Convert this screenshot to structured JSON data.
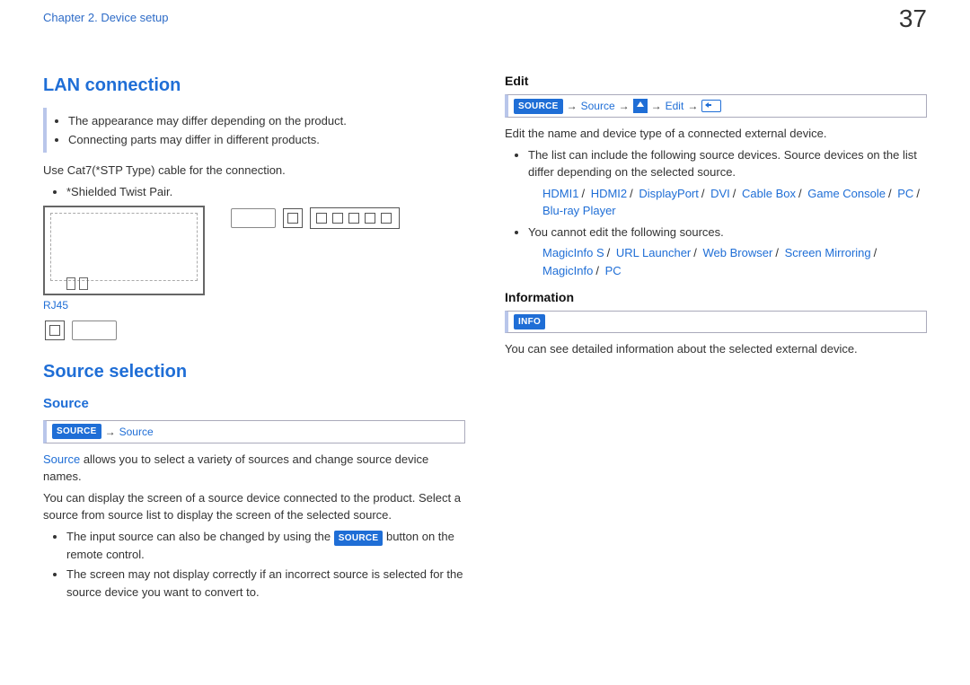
{
  "header": {
    "chapter": "Chapter 2. Device setup",
    "page_number": "37"
  },
  "left": {
    "lan_heading": "LAN connection",
    "lan_notes": [
      "The appearance may differ depending on the product.",
      "Connecting parts may differ in different products."
    ],
    "cable_line": "Use Cat7(*STP Type) cable for the connection.",
    "stp_note": "*Shielded Twist Pair.",
    "rj45_label": "RJ45",
    "source_sel_heading": "Source selection",
    "source_sub": "Source",
    "source_badge": "SOURCE",
    "source_path_text": "Source",
    "source_para_prefix": "Source",
    "source_para_rest": " allows you to select a variety of sources and change source device names.",
    "source_para2": "You can display the screen of a source device connected to the product. Select a source from source list to display the screen of the selected source.",
    "source_bullet1_pre": "The input source can also be changed by using the ",
    "source_bullet1_post": " button on the remote control.",
    "source_bullet2": "The screen may not display correctly if an incorrect source is selected for the source device you want to convert to."
  },
  "right": {
    "edit_heading": "Edit",
    "edit_badge": "SOURCE",
    "edit_path_source": "Source",
    "edit_path_edit": "Edit",
    "edit_intro": "Edit the name and device type of a connected external device.",
    "edit_bullet1": "The list can include the following source devices. Source devices on the list differ depending on the selected source.",
    "edit_sources1": [
      "HDMI1",
      "HDMI2",
      "DisplayPort",
      "DVI",
      "Cable Box",
      "Game Console",
      "PC",
      "Blu-ray Player"
    ],
    "edit_bullet2": "You cannot edit the following sources.",
    "edit_sources2": [
      "MagicInfo S",
      "URL Launcher",
      "Web Browser",
      "Screen Mirroring",
      "MagicInfo",
      "PC"
    ],
    "info_heading": "Information",
    "info_badge": "INFO",
    "info_text": "You can see detailed information about the selected external device."
  }
}
